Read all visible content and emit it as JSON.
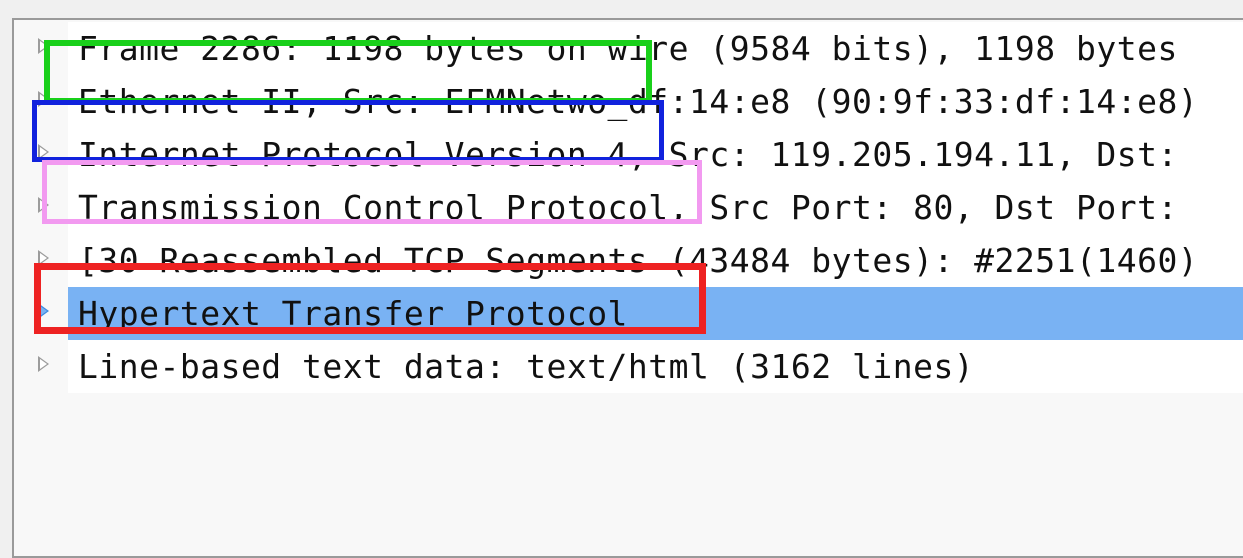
{
  "packet_details": {
    "rows": [
      {
        "label": "Frame 2286: 1198 bytes on wire (9584 bits), 1198 bytes",
        "expanded": false,
        "selected": false
      },
      {
        "label": "Ethernet II, Src: EFMNetwo_df:14:e8 (90:9f:33:df:14:e8)",
        "expanded": false,
        "selected": false
      },
      {
        "label": "Internet Protocol Version 4, Src: 119.205.194.11, Dst:",
        "expanded": false,
        "selected": false
      },
      {
        "label": "Transmission Control Protocol, Src Port: 80, Dst Port:",
        "expanded": false,
        "selected": false
      },
      {
        "label": "[30 Reassembled TCP Segments (43484 bytes): #2251(1460)",
        "expanded": false,
        "selected": false
      },
      {
        "label": "Hypertext Transfer Protocol",
        "expanded": false,
        "selected": true
      },
      {
        "label": "Line-based text data: text/html (3162 lines)",
        "expanded": false,
        "selected": false
      }
    ]
  },
  "colors": {
    "selection": "#79b2f3",
    "highlight_green": "#19d01a",
    "highlight_blue": "#1122dd",
    "highlight_pink": "#f29af0",
    "highlight_red": "#ee2222"
  },
  "icons": {
    "expander": "triangle-right-icon"
  }
}
